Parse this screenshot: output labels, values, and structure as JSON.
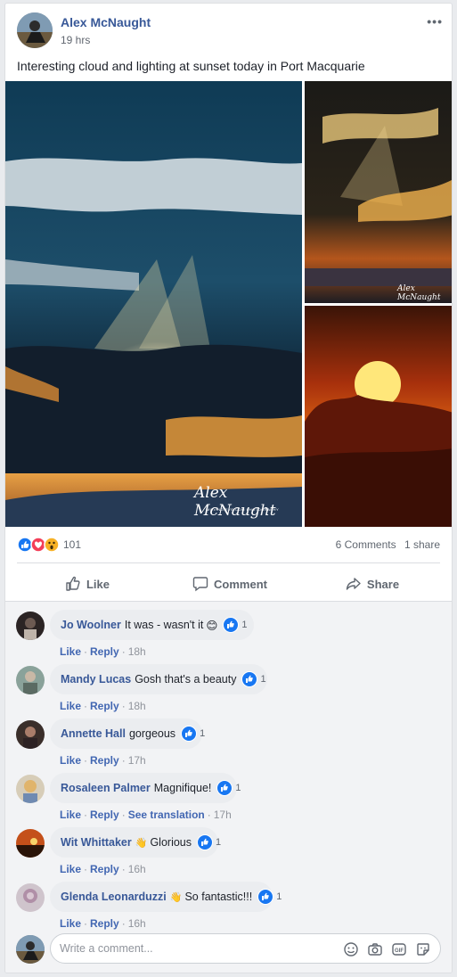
{
  "post": {
    "author": "Alex McNaught",
    "time": "19 hrs",
    "text": "Interesting cloud and lighting at sunset today in Port Macquarie",
    "more_label": "•••"
  },
  "photos": [
    {
      "name": "photo-main",
      "watermark": "Alex McNaught",
      "sub": "MOVING-EYE.COM PHOTOGRAPHY"
    },
    {
      "name": "photo-top-right",
      "watermark": "Alex McNaught",
      "sub": ""
    },
    {
      "name": "photo-bottom-right",
      "watermark": "",
      "sub": ""
    }
  ],
  "reactions": {
    "count": "101",
    "comments": "6 Comments",
    "shares": "1 share",
    "types": [
      "like-icon",
      "love-icon",
      "wow-icon"
    ]
  },
  "actions": {
    "like": "Like",
    "comment": "Comment",
    "share": "Share"
  },
  "comments": [
    {
      "name": "Jo Woolner",
      "text": "It was - wasn't it",
      "emoji": "😊",
      "likes": "1",
      "time": "18h",
      "extra": ""
    },
    {
      "name": "Mandy Lucas",
      "text": "Gosh that's a beauty",
      "emoji": "",
      "likes": "1",
      "time": "18h",
      "extra": ""
    },
    {
      "name": "Annette Hall",
      "text": "gorgeous",
      "emoji": "",
      "likes": "1",
      "time": "17h",
      "extra": ""
    },
    {
      "name": "Rosaleen Palmer",
      "text": "Magnifique!",
      "emoji": "",
      "likes": "1",
      "time": "17h",
      "extra": "See translation"
    },
    {
      "name": "Wit Whittaker",
      "text": "Glorious",
      "emoji": "👋",
      "likes": "1",
      "time": "16h",
      "extra": ""
    },
    {
      "name": "Glenda Leonarduzzi",
      "text": "So fantastic!!!",
      "emoji": "👋",
      "likes": "1",
      "time": "16h",
      "extra": ""
    }
  ],
  "comment_actions": {
    "like": "Like",
    "reply": "Reply"
  },
  "composer": {
    "placeholder": "Write a comment...",
    "icons": [
      "emoji-icon",
      "camera-icon",
      "gif-icon",
      "sticker-icon"
    ]
  },
  "colors": {
    "link": "#385898",
    "accent": "#1877f2",
    "love": "#f33e58",
    "wow": "#f7b125"
  }
}
